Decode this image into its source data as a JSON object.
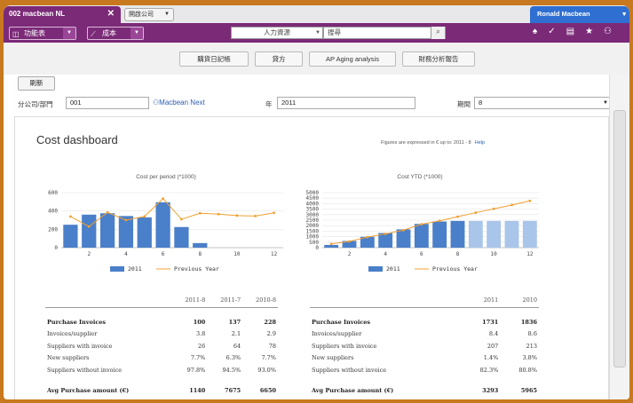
{
  "tabs": {
    "active_label": "002  macbean NL",
    "close_glyph": "✕",
    "second_label": "開啟公司",
    "user_name": "Ronald Macbean"
  },
  "menu": {
    "btn1": "功能表",
    "btn2": "成本",
    "select_value": "人力資源",
    "search_value": "搜尋"
  },
  "quick_buttons": [
    "購貨日記帳",
    "貸方",
    "AP Aging analysis",
    "財務分析報告"
  ],
  "refresh_label": "刷新",
  "filters": {
    "company_label": "分公司/部門",
    "company_value": "001",
    "next_link": "Macbean Next",
    "year_label": "年",
    "year_value": "2011",
    "period_label": "期間",
    "period_value": "8"
  },
  "dashboard": {
    "title": "Cost dashboard",
    "note": "Figures are expressed in € up to: 2011 - 8",
    "help": "Help"
  },
  "chart_data": [
    {
      "type": "bar",
      "title": "Cost per period (*1000)",
      "x": [
        1,
        2,
        3,
        4,
        5,
        6,
        7,
        8,
        9,
        10,
        11,
        12
      ],
      "series": [
        {
          "name": "2011",
          "type": "bar",
          "values": [
            250,
            360,
            375,
            345,
            330,
            495,
            225,
            50,
            null,
            null,
            null,
            null
          ]
        },
        {
          "name": "Previous Year",
          "type": "line",
          "values": [
            340,
            230,
            385,
            300,
            340,
            535,
            310,
            375,
            365,
            350,
            345,
            380
          ]
        }
      ],
      "ylim": [
        0,
        600
      ],
      "yticks": [
        0,
        200,
        400,
        600
      ],
      "xticks": [
        2,
        4,
        6,
        8,
        10,
        12
      ],
      "colors": {
        "bar": "#4a7fc9",
        "line": "#f0a030"
      }
    },
    {
      "type": "bar",
      "title": "Cost YTD (*1000)",
      "x": [
        1,
        2,
        3,
        4,
        5,
        6,
        7,
        8,
        9,
        10,
        11,
        12
      ],
      "series": [
        {
          "name": "2011",
          "type": "bar",
          "values": [
            250,
            610,
            985,
            1330,
            1660,
            2155,
            2380,
            2430,
            2430,
            2430,
            2430,
            2430
          ],
          "actual_through": 8
        },
        {
          "name": "Previous Year",
          "type": "line",
          "values": [
            340,
            570,
            955,
            1255,
            1595,
            2130,
            2440,
            2815,
            3180,
            3530,
            3875,
            4255
          ]
        }
      ],
      "ylim": [
        0,
        5000
      ],
      "yticks": [
        0,
        500,
        1000,
        1500,
        2000,
        2500,
        3000,
        3500,
        4000,
        4500,
        5000
      ],
      "xticks": [
        2,
        4,
        6,
        8,
        10,
        12
      ],
      "colors": {
        "bar": "#4a7fc9",
        "bar_projected": "#a9c5ea",
        "line": "#f0a030"
      }
    }
  ],
  "table_left": {
    "headers": [
      "",
      "2011-8",
      "2011-7",
      "2010-8"
    ],
    "rows": [
      {
        "label": "Purchase Invoices",
        "values": [
          "100",
          "137",
          "228"
        ],
        "bold": true
      },
      {
        "label": "Invoices/supplier",
        "values": [
          "3.8",
          "2.1",
          "2.9"
        ]
      },
      {
        "label": "Suppliers with invoice",
        "values": [
          "26",
          "64",
          "78"
        ]
      },
      {
        "label": "New suppliers",
        "values": [
          "7.7%",
          "6.3%",
          "7.7%"
        ]
      },
      {
        "label": "Suppliers without invoice",
        "values": [
          "97.8%",
          "94.5%",
          "93.0%"
        ]
      },
      {
        "label": "Avg Purchase amount (€)",
        "values": [
          "1140",
          "7675",
          "6650"
        ],
        "bold": true,
        "gap": true
      }
    ]
  },
  "table_right": {
    "headers": [
      "",
      "2011",
      "2010"
    ],
    "rows": [
      {
        "label": "Purchase Invoices",
        "values": [
          "1731",
          "1836"
        ],
        "bold": true
      },
      {
        "label": "Invoices/supplier",
        "values": [
          "8.4",
          "8.6"
        ]
      },
      {
        "label": "Suppliers with invoice",
        "values": [
          "207",
          "213"
        ]
      },
      {
        "label": "New suppliers",
        "values": [
          "1.4%",
          "3.8%"
        ]
      },
      {
        "label": "Suppliers without invoice",
        "values": [
          "82.3%",
          "80.8%"
        ]
      },
      {
        "label": "Avg Purchase amount (€)",
        "values": [
          "3293",
          "5965"
        ],
        "bold": true,
        "gap": true
      }
    ]
  }
}
